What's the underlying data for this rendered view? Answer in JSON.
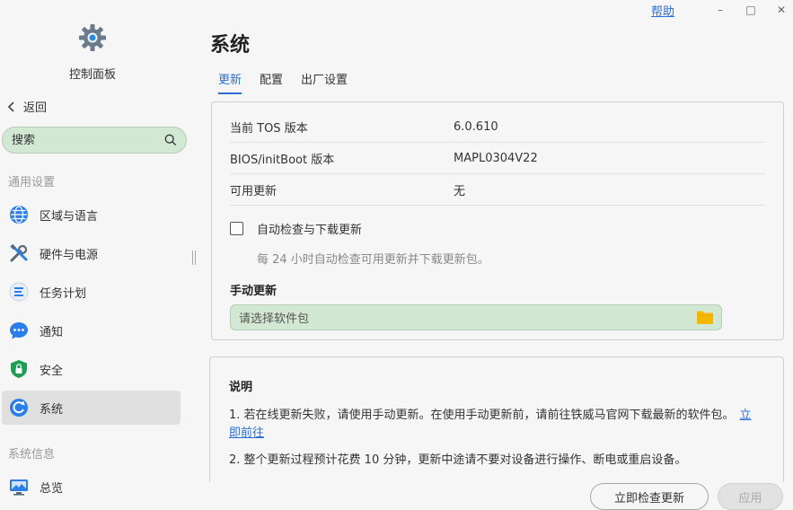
{
  "window": {
    "help_label": "帮助",
    "minimize_glyph": "–",
    "maximize_glyph": "□",
    "close_glyph": "✕"
  },
  "sidebar": {
    "header_title": "控制面板",
    "back_label": "返回",
    "search_placeholder": "搜索",
    "section_general": "通用设置",
    "items": [
      {
        "label": "区域与语言",
        "icon": "globe-icon"
      },
      {
        "label": "硬件与电源",
        "icon": "tools-icon"
      },
      {
        "label": "任务计划",
        "icon": "task-list-icon"
      },
      {
        "label": "通知",
        "icon": "chat-bubble-icon"
      },
      {
        "label": "安全",
        "icon": "shield-lock-icon"
      },
      {
        "label": "系统",
        "icon": "system-refresh-icon",
        "active": true
      }
    ],
    "section_info": "系统信息",
    "info_items": [
      {
        "label": "总览",
        "icon": "monitor-icon"
      }
    ]
  },
  "main": {
    "title": "系统",
    "tabs": [
      {
        "label": "更新",
        "active": true
      },
      {
        "label": "配置"
      },
      {
        "label": "出厂设置"
      }
    ],
    "update": {
      "rows": [
        {
          "key": "当前 TOS 版本",
          "value": "6.0.610"
        },
        {
          "key": "BIOS/initBoot 版本",
          "value": "MAPL0304V22"
        },
        {
          "key": "可用更新",
          "value": "无"
        }
      ],
      "auto_check_label": "自动检查与下载更新",
      "auto_check_checked": false,
      "auto_check_hint": "每 24 小时自动检查可用更新并下载更新包。",
      "manual_title": "手动更新",
      "file_placeholder": "请选择软件包"
    },
    "notes": {
      "title": "说明",
      "note1": "1. 若在线更新失败，请使用手动更新。在使用手动更新前，请前往铁威马官网下载最新的软件包。",
      "note1_link": "立即前往",
      "note2": "2. 整个更新过程预计花费 10 分钟，更新中途请不要对设备进行操作、断电或重启设备。"
    },
    "buttons": {
      "check_now": "立即检查更新",
      "apply": "应用"
    }
  },
  "colors": {
    "accent": "#2a6fd6",
    "highlight_green": "#d2e8d2",
    "active_item": "#e0e0e0",
    "folder": "#f5b800"
  }
}
